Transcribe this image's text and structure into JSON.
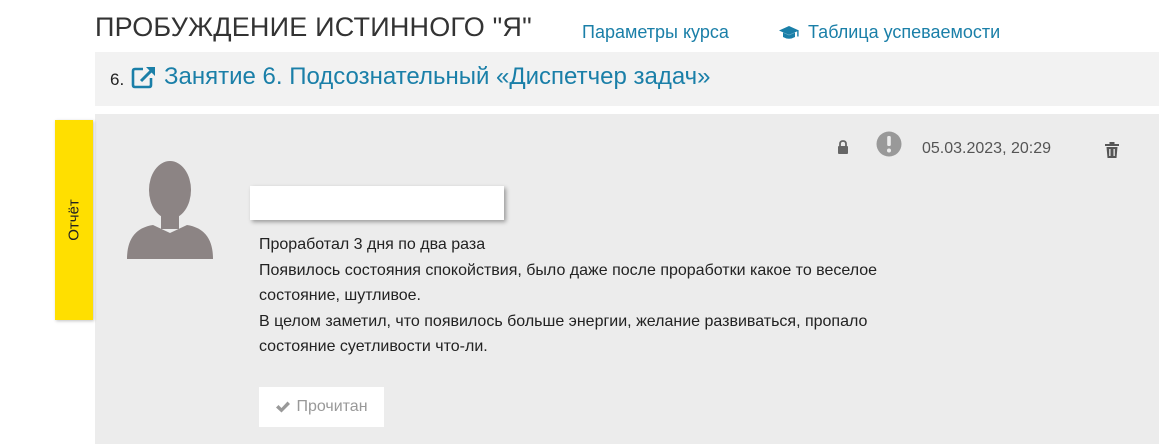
{
  "header": {
    "course_title": "ПРОБУЖДЕНИЕ ИСТИННОГО \"Я\"",
    "course_params_link": "Параметры курса",
    "grades_link": "Таблица успеваемости",
    "grades_icon": "graduation-cap-icon"
  },
  "lesson": {
    "number": "6.",
    "link_icon": "external-link-icon",
    "title": "Занятие 6. Подсознательный «Диспетчер задач»"
  },
  "report": {
    "tab_label": "Отчёт",
    "tab_color": "#ffdf00",
    "avatar_icon": "user-avatar-icon",
    "lock_icon": "lock-icon",
    "alert_icon": "exclamation-circle-icon",
    "date": "05.03.2023, 20:29",
    "delete_icon": "trash-icon",
    "lines": [
      "Проработал 3 дня по два раза",
      "Появилось состояния спокойствия, было даже после проработки какое то веселое",
      "состояние, шутливое.",
      "В целом заметил, что появилось больше энергии, желание развиваться, пропало",
      "состояние суетливости что-ли."
    ],
    "read_button": "Прочитан",
    "read_icon": "checkmark-icon"
  },
  "colors": {
    "link": "#1a7fa8",
    "panel_bg": "#ececec",
    "lesson_bar_bg": "#f2f2f2"
  }
}
